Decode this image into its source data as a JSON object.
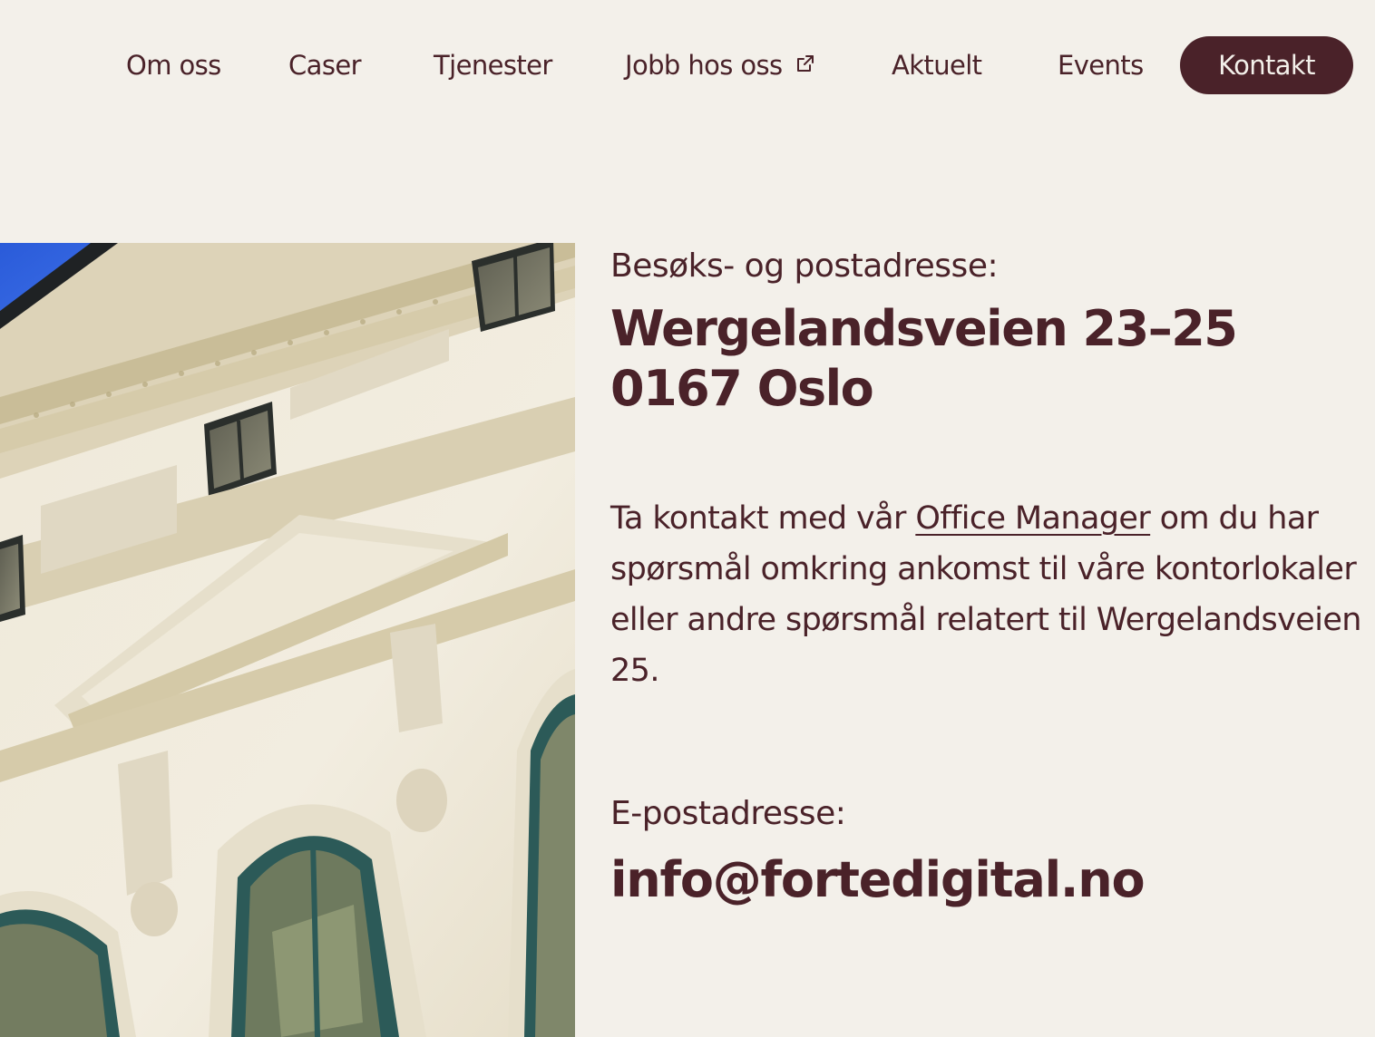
{
  "nav": {
    "items": [
      {
        "label": "Om oss"
      },
      {
        "label": "Caser"
      },
      {
        "label": "Tjenester"
      },
      {
        "label": "Jobb hos oss",
        "icon": "external-link-icon"
      },
      {
        "label": "Aktuelt"
      },
      {
        "label": "Events"
      }
    ],
    "cta_label": "Kontakt"
  },
  "address": {
    "label": "Besøks- og postadresse:",
    "line1": "Wergelandsveien 23–25",
    "line2": "0167 Oslo"
  },
  "contact": {
    "text_before": "Ta kontakt med vår ",
    "link_label": "Office Manager",
    "text_after": " om du har spørsmål omkring ankomst til våre kontorlokaler eller andre spørsmål relatert til Wergelandsveien 25."
  },
  "email": {
    "label": "E-postadresse:",
    "value": "info@fortedigital.no"
  },
  "colors": {
    "background": "#f3f0ea",
    "brand": "#4a2229",
    "window_frame": "#2c5a58"
  }
}
